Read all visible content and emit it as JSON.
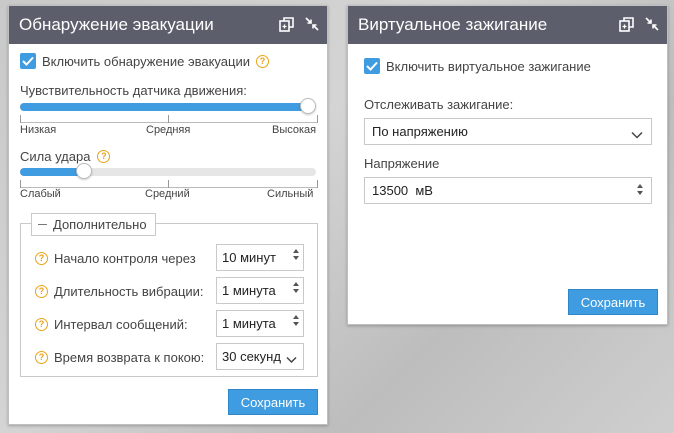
{
  "left_panel": {
    "title": "Обнаружение эвакуации",
    "enable_label": "Включить обнаружение эвакуации",
    "sensitivity_label": "Чувствительность датчика движения:",
    "sensitivity_ticks": [
      "Низкая",
      "Средняя",
      "Высокая"
    ],
    "sensitivity_value": 1.0,
    "impact_label": "Сила удара",
    "impact_ticks": [
      "Слабый",
      "Средний",
      "Сильный"
    ],
    "impact_value": 0.2,
    "advanced_label": "Дополнительно",
    "fields": [
      {
        "label": "Начало контроля через",
        "value": "10 минут"
      },
      {
        "label": "Длительность вибрации:",
        "value": "1 минута"
      },
      {
        "label": "Интервал сообщений:",
        "value": "1 минута"
      },
      {
        "label": "Время возврата к покою:",
        "value": "30 секунд"
      }
    ],
    "save_label": "Сохранить"
  },
  "right_panel": {
    "title": "Виртуальное зажигание",
    "enable_label": "Включить виртуальное зажигание",
    "track_label": "Отслеживать зажигание:",
    "track_value": "По напряжению",
    "voltage_label": "Напряжение",
    "voltage_value": "13500  мВ",
    "save_label": "Сохранить"
  },
  "colors": {
    "header_bg": "#5c5f6b",
    "accent": "#3f9ce0",
    "help_icon": "#e8a317"
  }
}
